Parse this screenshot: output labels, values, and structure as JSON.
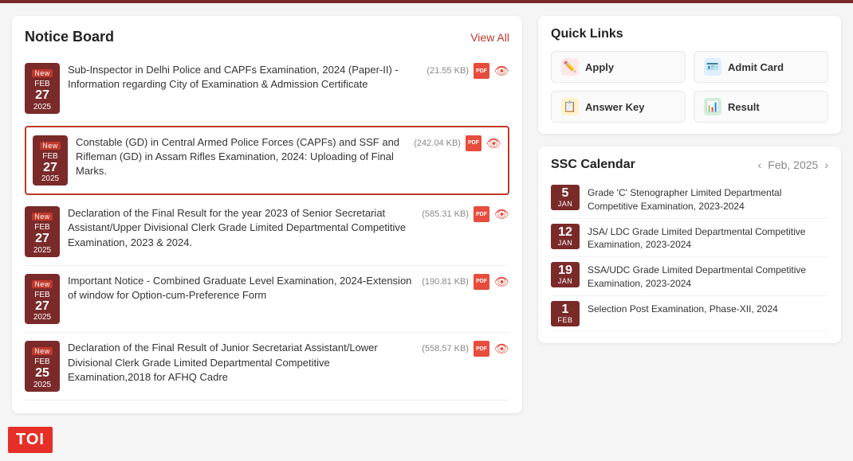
{
  "noticeboard": {
    "title": "Notice Board",
    "view_all": "View All",
    "items": [
      {
        "is_new": true,
        "month": "Feb",
        "day": "27",
        "year": "2025",
        "text": "Sub-Inspector in Delhi Police and CAPFs Examination, 2024 (Paper-II) - Information regarding City of Examination & Admission Certificate",
        "size": "(21.55 KB)",
        "highlighted": false
      },
      {
        "is_new": true,
        "month": "Feb",
        "day": "27",
        "year": "2025",
        "text": "Constable (GD) in Central Armed Police Forces (CAPFs) and SSF and Rifleman (GD) in Assam Rifles Examination, 2024: Uploading of Final Marks.",
        "size": "(242.04 KB)",
        "highlighted": true
      },
      {
        "is_new": true,
        "month": "Feb",
        "day": "27",
        "year": "2025",
        "text": "Declaration of the Final Result for the year 2023 of Senior Secretariat Assistant/Upper Divisional Clerk Grade Limited Departmental Competitive Examination, 2023 & 2024.",
        "size": "(585.31 KB)",
        "highlighted": false
      },
      {
        "is_new": true,
        "month": "Feb",
        "day": "27",
        "year": "2025",
        "text": "Important Notice - Combined Graduate Level Examination, 2024-Extension of window for Option-cum-Preference Form",
        "size": "(190.81 KB)",
        "highlighted": false
      },
      {
        "is_new": true,
        "month": "Feb",
        "day": "25",
        "year": "2025",
        "text": "Declaration of the Final Result of Junior Secretariat Assistant/Lower Divisional Clerk Grade Limited Departmental Competitive Examination,2018 for AFHQ Cadre",
        "size": "(558.57 KB)",
        "highlighted": false
      }
    ]
  },
  "quicklinks": {
    "title": "Quick Links",
    "items": [
      {
        "label": "Apply",
        "icon": "✏️",
        "type": "apply"
      },
      {
        "label": "Admit Card",
        "icon": "🪪",
        "type": "admit"
      },
      {
        "label": "Answer Key",
        "icon": "📋",
        "type": "answer"
      },
      {
        "label": "Result",
        "icon": "📊",
        "type": "result"
      }
    ]
  },
  "calendar": {
    "title": "SSC Calendar",
    "month": "Feb, 2025",
    "items": [
      {
        "day": "5",
        "month": "JAN",
        "text": "Grade 'C' Stenographer Limited Departmental Competitive Examination, 2023-2024"
      },
      {
        "day": "12",
        "month": "JAN",
        "text": "JSA/ LDC Grade Limited Departmental Competitive Examination, 2023-2024"
      },
      {
        "day": "19",
        "month": "JAN",
        "text": "SSA/UDC Grade Limited Departmental Competitive Examination, 2023-2024"
      },
      {
        "day": "1",
        "month": "FEB",
        "text": "Selection Post Examination, Phase-XII, 2024"
      }
    ]
  },
  "toi": {
    "label": "TOI"
  }
}
